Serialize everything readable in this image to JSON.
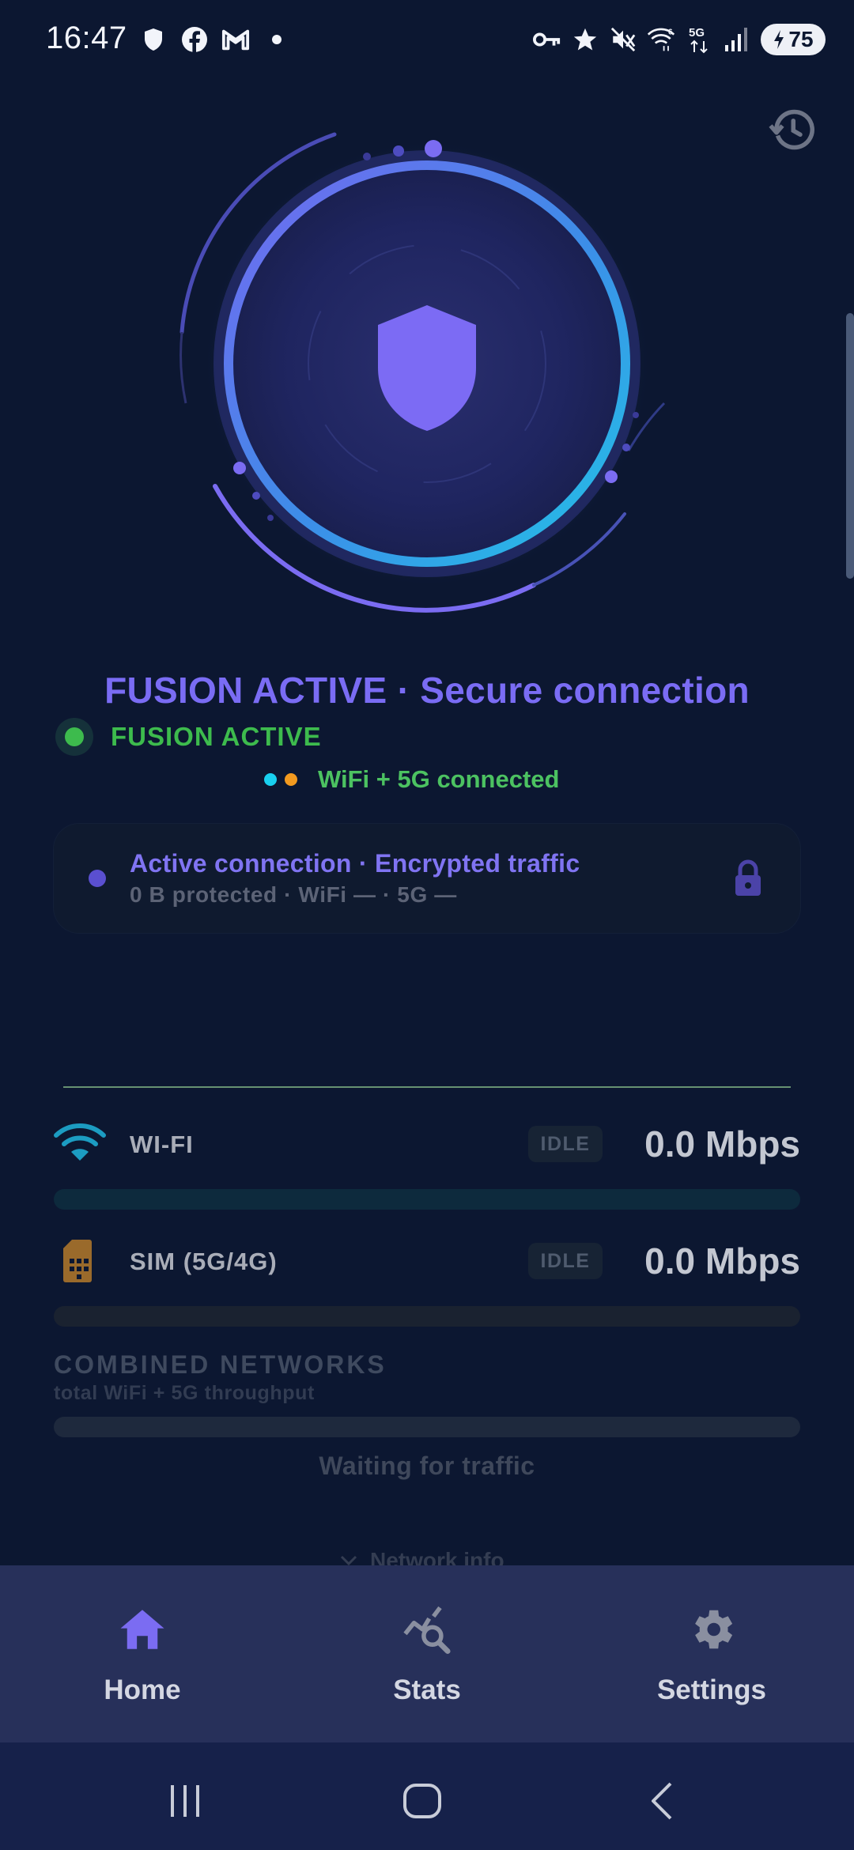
{
  "status_bar": {
    "time": "16:47",
    "left_icons": [
      "shield-notification-icon",
      "facebook-icon",
      "gmail-icon",
      "dot-icon"
    ],
    "right_icons": [
      "vpn-key-icon",
      "star-icon",
      "mute-icon",
      "wifi-6-icon",
      "5g-icon",
      "signal-icon"
    ],
    "battery": "75"
  },
  "hero": {
    "title": "FUSION ACTIVE · Secure connection",
    "badge": "FUSION ACTIVE",
    "network_status": "WiFi + 5G connected",
    "dot_colors": [
      "#19d0f0",
      "#f39a1f"
    ]
  },
  "active_card": {
    "title": "Active connection · Encrypted traffic",
    "subtitle": "0 B protected · WiFi — · 5G —"
  },
  "networks": {
    "wifi": {
      "label": "WI-FI",
      "state": "IDLE",
      "speed": "0.0 Mbps"
    },
    "sim": {
      "label": "SIM (5G/4G)",
      "state": "IDLE",
      "speed": "0.0 Mbps"
    }
  },
  "combined": {
    "title": "COMBINED NETWORKS",
    "subtitle": "total WiFi + 5G throughput",
    "waiting": "Waiting for traffic"
  },
  "network_info": {
    "label": "Network info"
  },
  "bottom_nav": {
    "items": [
      {
        "label": "Home",
        "icon": "home-icon"
      },
      {
        "label": "Stats",
        "icon": "stats-icon"
      },
      {
        "label": "Settings",
        "icon": "gear-icon"
      }
    ]
  },
  "colors": {
    "accent": "#7a6cf4",
    "active_green": "#3dbb4d",
    "background": "#0c1731",
    "nav_bar": "#27305a"
  }
}
